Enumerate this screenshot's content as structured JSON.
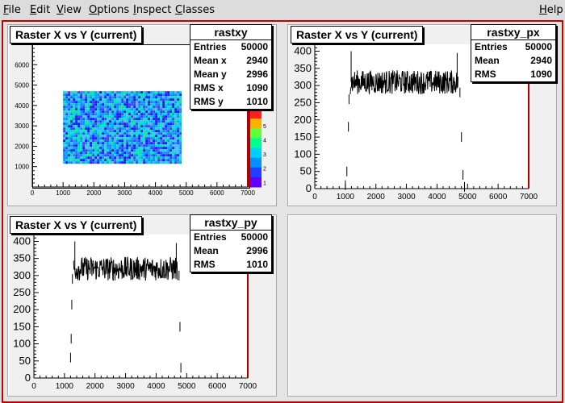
{
  "menubar": {
    "items": [
      {
        "label": "File",
        "accel": "F",
        "rest": "ile"
      },
      {
        "label": "Edit",
        "accel": "E",
        "rest": "dit"
      },
      {
        "label": "View",
        "accel": "V",
        "rest": "iew"
      },
      {
        "label": "Options",
        "accel": "O",
        "rest": "ptions"
      },
      {
        "label": "Inspect",
        "accel": "I",
        "rest": "nspect"
      },
      {
        "label": "Classes",
        "accel": "C",
        "rest": "lasses"
      }
    ],
    "help": {
      "label": "Help",
      "accel": "H",
      "rest": "elp"
    }
  },
  "pad1": {
    "title": "Raster X vs Y (current)",
    "stats": {
      "name": "rastxy",
      "rows": [
        {
          "label": "Entries",
          "value": "50000"
        },
        {
          "label": "Mean x",
          "value": "2940"
        },
        {
          "label": "Mean y",
          "value": "2996"
        },
        {
          "label": "RMS x",
          "value": "1090"
        },
        {
          "label": "RMS y",
          "value": "1010"
        }
      ]
    },
    "palette_ticks": [
      "1",
      "2",
      "3",
      "4",
      "5"
    ]
  },
  "pad2": {
    "title": "Raster X vs Y (current)",
    "stats": {
      "name": "rastxy_px",
      "rows": [
        {
          "label": "Entries",
          "value": "50000"
        },
        {
          "label": "Mean",
          "value": "2940"
        },
        {
          "label": "RMS",
          "value": "1090"
        }
      ]
    }
  },
  "pad3": {
    "title": "Raster X vs Y (current)",
    "stats": {
      "name": "rastxy_py",
      "rows": [
        {
          "label": "Entries",
          "value": "50000"
        },
        {
          "label": "Mean",
          "value": "2996"
        },
        {
          "label": "RMS",
          "value": "1010"
        }
      ]
    }
  },
  "colors": {
    "frame": "#c40000",
    "axis_red": "#b00000"
  },
  "chart_data": [
    {
      "type": "heatmap",
      "title": "Raster X vs Y (current)",
      "x_range": [
        0,
        7000
      ],
      "y_range": [
        0,
        7000
      ],
      "x_ticks": [
        "0",
        "1000",
        "2000",
        "3000",
        "4000",
        "5000",
        "6000",
        "7000"
      ],
      "y_ticks": [
        "1000",
        "2000",
        "3000",
        "4000",
        "5000",
        "6000"
      ],
      "filled_region": {
        "x": [
          1000,
          4800
        ],
        "y": [
          1200,
          4700
        ]
      },
      "z_range": [
        0,
        5
      ]
    },
    {
      "type": "line",
      "title": "Raster X vs Y (current)",
      "x_range": [
        0,
        7000
      ],
      "y_range": [
        0,
        420
      ],
      "x_ticks": [
        "0",
        "1000",
        "2000",
        "3000",
        "4000",
        "5000",
        "6000",
        "7000"
      ],
      "y_ticks": [
        "0",
        "50",
        "100",
        "150",
        "200",
        "250",
        "300",
        "350",
        "400"
      ],
      "plateau": {
        "x": [
          1150,
          4700
        ],
        "level": 310
      },
      "edge_points": [
        [
          1000,
          10
        ],
        [
          1050,
          50
        ],
        [
          1100,
          180
        ],
        [
          1120,
          260
        ],
        [
          4750,
          280
        ],
        [
          4800,
          150
        ],
        [
          4850,
          40
        ],
        [
          4900,
          5
        ]
      ]
    },
    {
      "type": "line",
      "title": "Raster X vs Y (current)",
      "x_range": [
        0,
        7000
      ],
      "y_range": [
        0,
        420
      ],
      "x_ticks": [
        "0",
        "1000",
        "2000",
        "3000",
        "4000",
        "5000",
        "6000",
        "7000"
      ],
      "y_ticks": [
        "0",
        "50",
        "100",
        "150",
        "200",
        "250",
        "300",
        "350",
        "400"
      ],
      "plateau": {
        "x": [
          1300,
          4700
        ],
        "level": 320
      },
      "edge_points": [
        [
          1200,
          60
        ],
        [
          1220,
          115
        ],
        [
          1240,
          215
        ],
        [
          1260,
          290
        ],
        [
          4750,
          300
        ],
        [
          4780,
          150
        ],
        [
          4810,
          30
        ]
      ]
    }
  ]
}
